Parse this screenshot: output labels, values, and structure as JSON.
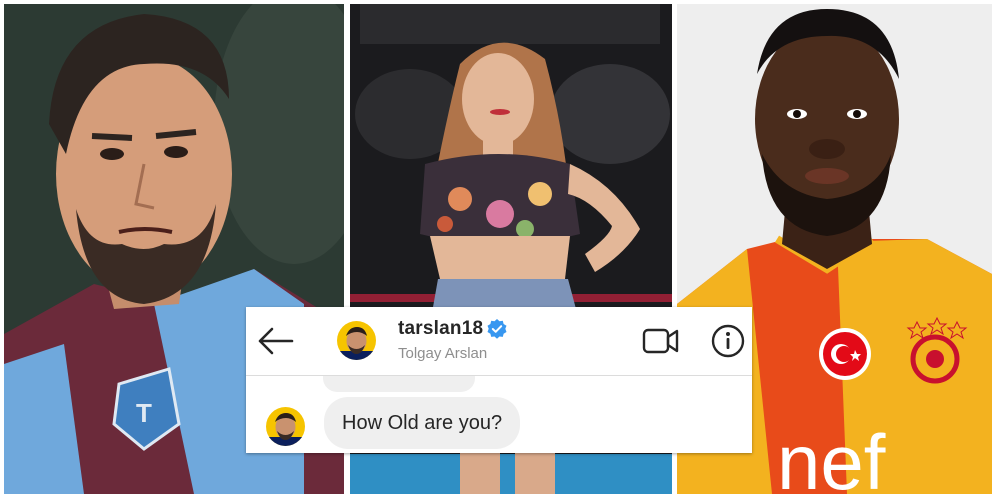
{
  "photos": {
    "left": {
      "jersey_badge_icon": "trabzonspor-crest-icon"
    },
    "right": {
      "sponsor_text": "nef",
      "crest_icon": "galatasaray-crest-icon",
      "flag_icon": "turkey-flag-icon"
    }
  },
  "dm": {
    "header": {
      "back_icon": "arrow-left-icon",
      "username": "tarslan18",
      "verified_icon": "verified-badge-icon",
      "full_name": "Tolgay Arslan",
      "video_icon": "video-camera-icon",
      "info_icon": "info-icon"
    },
    "messages": [
      {
        "text": "How Old are you?"
      }
    ]
  },
  "colors": {
    "verified_blue": "#3897f0",
    "bubble_gray": "#efefef",
    "username_text": "#262626",
    "subtitle_text": "#8e8e8e"
  }
}
